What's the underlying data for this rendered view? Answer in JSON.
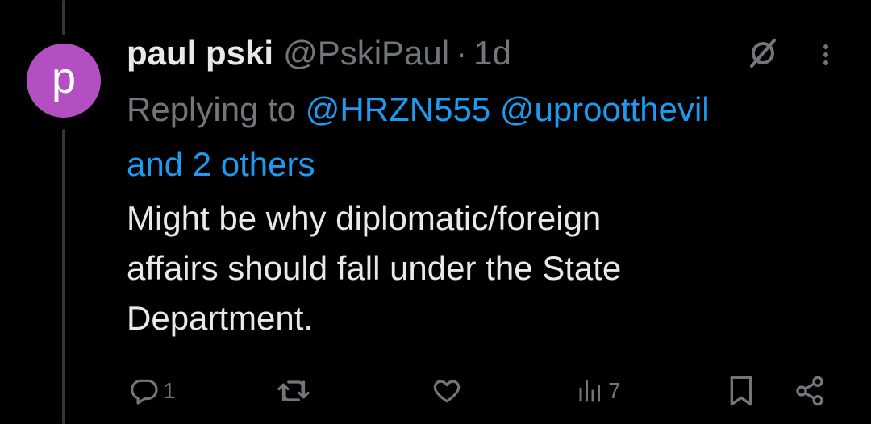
{
  "tweet": {
    "avatar_letter": "p",
    "author_name": "paul pski",
    "author_handle": "@PskiPaul",
    "separator": "·",
    "timestamp": "1d",
    "replying_to_prefix": "Replying to ",
    "mention_1": "@HRZN555",
    "mention_2": "@uprootthevil",
    "others": "and 2 others",
    "body_line_1": "Might be why diplomatic/foreign",
    "body_line_2": "affairs should fall under the State",
    "body_line_3": "Department.",
    "reply_count": "1",
    "retweet_count": "",
    "like_count": "",
    "view_count": "7"
  },
  "icons": {
    "reply": "reply-icon",
    "retweet": "retweet-icon",
    "like": "heart-icon",
    "views": "views-icon",
    "bookmark": "bookmark-icon",
    "share": "share-icon",
    "grok": "grok-icon",
    "more": "more-icon"
  },
  "colors": {
    "background": "#000000",
    "avatar": "#b34fc2",
    "link": "#1d9bf0",
    "secondary_text": "#71767b",
    "primary_text": "#e7e9ea"
  }
}
